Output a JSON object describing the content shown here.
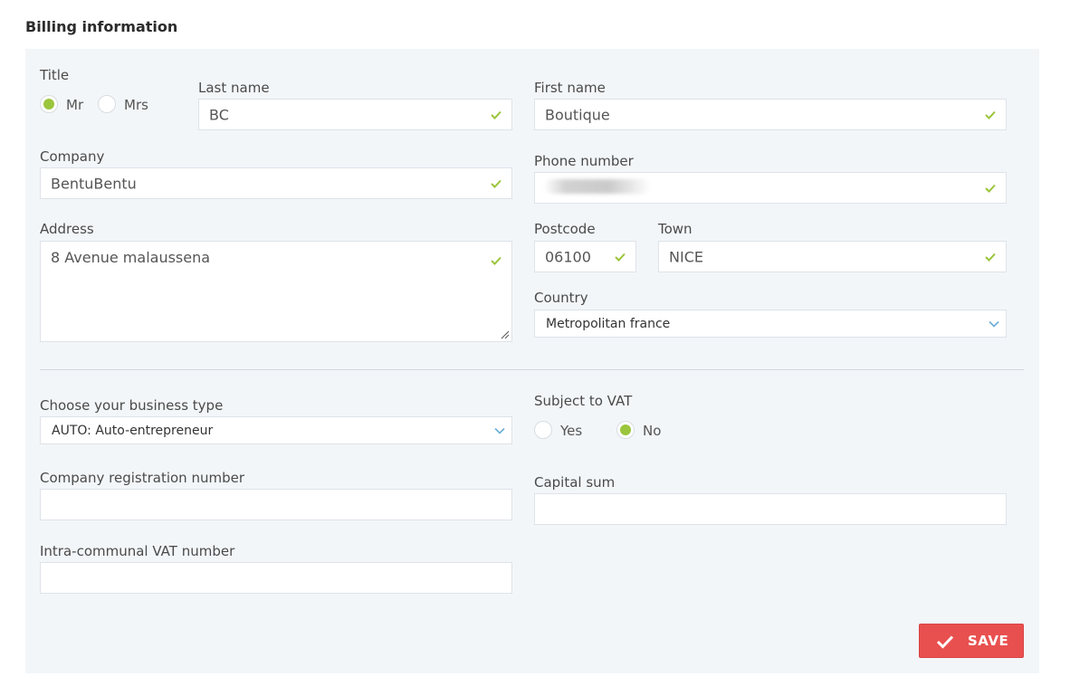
{
  "section": {
    "title": "Billing information"
  },
  "title_field": {
    "label": "Title",
    "options": [
      "Mr",
      "Mrs"
    ],
    "selected": "Mr"
  },
  "last_name": {
    "label": "Last name",
    "value": "BC"
  },
  "first_name": {
    "label": "First name",
    "value": "Boutique"
  },
  "company": {
    "label": "Company",
    "value": "BentuBentu"
  },
  "phone": {
    "label": "Phone number",
    "value": ""
  },
  "address": {
    "label": "Address",
    "value": "8 Avenue malaussena"
  },
  "postcode": {
    "label": "Postcode",
    "value": "06100"
  },
  "town": {
    "label": "Town",
    "value": "NICE"
  },
  "country": {
    "label": "Country",
    "selected": "Metropolitan france"
  },
  "business_type": {
    "label": "Choose your business type",
    "selected": "AUTO: Auto-entrepreneur"
  },
  "vat": {
    "label": "Subject to VAT",
    "options": [
      "Yes",
      "No"
    ],
    "selected": "No"
  },
  "registration_number": {
    "label": "Company registration number",
    "value": ""
  },
  "capital_sum": {
    "label": "Capital sum",
    "value": ""
  },
  "intra_vat": {
    "label": "Intra-communal VAT number",
    "value": ""
  },
  "save": {
    "label": "SAVE"
  },
  "colors": {
    "accent_green": "#9bc53d",
    "save_red": "#e8504f",
    "panel_bg": "#f3f6f9",
    "chevron_blue": "#6aaed6"
  }
}
